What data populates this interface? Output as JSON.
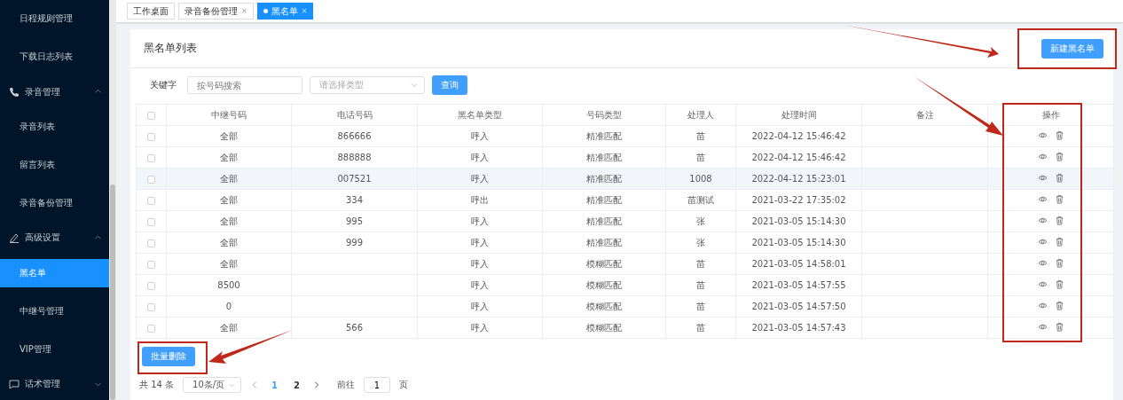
{
  "sidebar": {
    "items": [
      {
        "label": "日程规则管理",
        "kind": "leaf",
        "selected": false
      },
      {
        "label": "下载日志列表",
        "kind": "leaf",
        "selected": false
      },
      {
        "label": "录音管理",
        "kind": "group",
        "expanded": true
      },
      {
        "label": "录音列表",
        "kind": "leaf",
        "selected": false
      },
      {
        "label": "留言列表",
        "kind": "leaf",
        "selected": false
      },
      {
        "label": "录音备份管理",
        "kind": "leaf",
        "selected": false
      },
      {
        "label": "高级设置",
        "kind": "group",
        "expanded": true
      },
      {
        "label": "黑名单",
        "kind": "leaf",
        "selected": true
      },
      {
        "label": "中继号管理",
        "kind": "leaf",
        "selected": false
      },
      {
        "label": "VIP管理",
        "kind": "leaf",
        "selected": false
      },
      {
        "label": "话术管理",
        "kind": "group",
        "expanded": false
      }
    ]
  },
  "tabs": [
    {
      "label": "工作桌面",
      "selected": false,
      "closable": false
    },
    {
      "label": "录音备份管理",
      "selected": false,
      "closable": true
    },
    {
      "label": "黑名单",
      "selected": true,
      "closable": true
    }
  ],
  "close_glyph": "×",
  "card": {
    "title": "黑名单列表",
    "new_button": "新建黑名单"
  },
  "filter": {
    "label": "关键字",
    "search_placeholder": "按号码搜索",
    "type_placeholder": "请选择类型",
    "query_button": "查询"
  },
  "table": {
    "header_checked": false,
    "columns": [
      "中继号码",
      "电话号码",
      "黑名单类型",
      "号码类型",
      "处理人",
      "处理时间",
      "备注",
      "操作"
    ],
    "rows": [
      {
        "trunk": "全部",
        "phone": "866666",
        "list_type": "呼入",
        "match": "精准匹配",
        "handler": "苗",
        "time": "2022-04-12 15:46:42",
        "checked": false,
        "highlighted": false
      },
      {
        "trunk": "全部",
        "phone": "888888",
        "list_type": "呼入",
        "match": "精准匹配",
        "handler": "苗",
        "time": "2022-04-12 15:46:42",
        "checked": false,
        "highlighted": false
      },
      {
        "trunk": "全部",
        "phone": "007521",
        "list_type": "呼入",
        "match": "精准匹配",
        "handler": "1008",
        "time": "2022-04-12 15:23:01",
        "checked": false,
        "highlighted": true
      },
      {
        "trunk": "全部",
        "phone": "334",
        "list_type": "呼出",
        "match": "精准匹配",
        "handler": "苗测试",
        "time": "2021-03-22 17:35:02",
        "checked": false,
        "highlighted": false
      },
      {
        "trunk": "全部",
        "phone": "995",
        "list_type": "呼入",
        "match": "精准匹配",
        "handler": "张",
        "time": "2021-03-05 15:14:30",
        "checked": false,
        "highlighted": false
      },
      {
        "trunk": "全部",
        "phone": "999",
        "list_type": "呼入",
        "match": "精准匹配",
        "handler": "张",
        "time": "2021-03-05 15:14:30",
        "checked": false,
        "highlighted": false
      },
      {
        "trunk": "全部",
        "list_type": "呼入",
        "match": "模糊匹配",
        "handler": "苗",
        "time": "2021-03-05 14:58:01",
        "checked": false,
        "highlighted": false
      },
      {
        "trunk": "8500",
        "list_type": "呼入",
        "match": "模糊匹配",
        "handler": "苗",
        "time": "2021-03-05 14:57:55",
        "checked": false,
        "highlighted": false
      },
      {
        "trunk": "0",
        "list_type": "呼入",
        "match": "模糊匹配",
        "handler": "苗",
        "time": "2021-03-05 14:57:50",
        "checked": false,
        "highlighted": false
      },
      {
        "trunk": "全部",
        "phone": "566",
        "list_type": "呼入",
        "match": "模糊匹配",
        "handler": "苗",
        "time": "2021-03-05 14:57:43",
        "checked": false,
        "highlighted": false
      }
    ]
  },
  "batch_delete": "批量删除",
  "pagination": {
    "total": "共 14 条",
    "page_size": "10条/页",
    "pages": [
      {
        "label": "1",
        "selected": true
      },
      {
        "label": "2",
        "selected": false
      }
    ],
    "goto_label": "前往",
    "goto_value": "1",
    "goto_suffix": "页"
  }
}
